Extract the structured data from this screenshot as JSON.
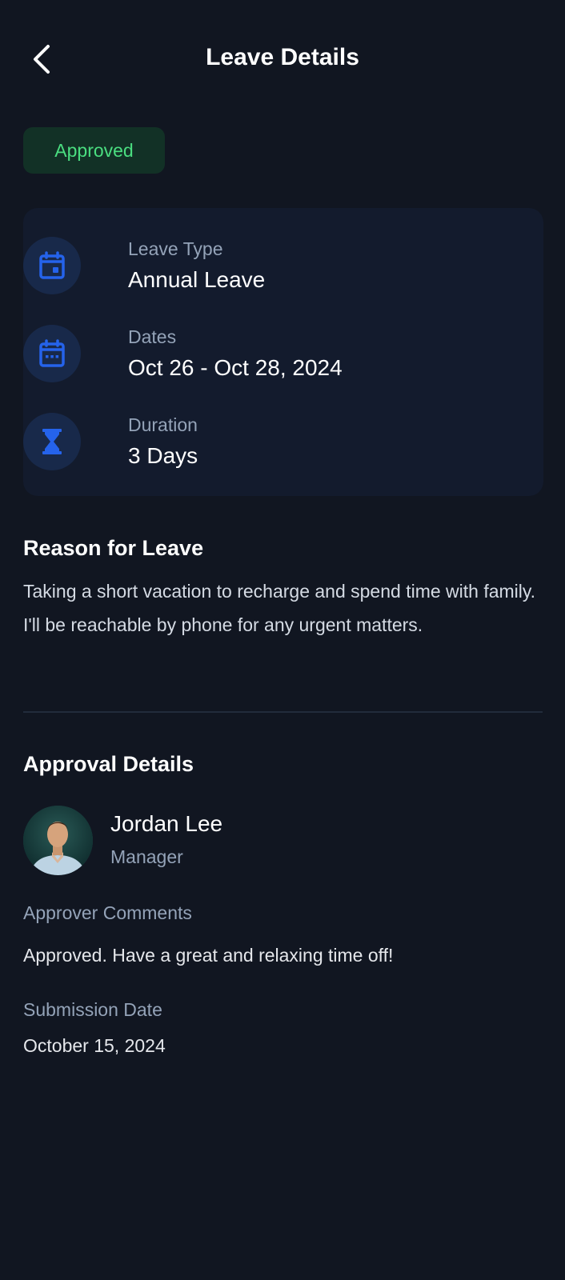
{
  "header": {
    "title": "Leave Details",
    "back_icon": "chevron-left-icon"
  },
  "status": {
    "label": "Approved",
    "color": "#4ade80",
    "background": "#123126"
  },
  "summary": {
    "items": [
      {
        "label": "Leave Type",
        "value": "Annual Leave",
        "icon": "calendar-event-icon"
      },
      {
        "label": "Dates",
        "value": "Oct 26 - Oct 28, 2024",
        "icon": "calendar-dots-icon"
      },
      {
        "label": "Duration",
        "value": "3 Days",
        "icon": "hourglass-icon"
      }
    ],
    "icon_color": "#2563eb"
  },
  "reason": {
    "title": "Reason for Leave",
    "text": "Taking a short vacation to recharge and spend time with family. I'll be reachable by phone for any urgent matters."
  },
  "approval": {
    "title": "Approval Details",
    "approver": {
      "name": "Jordan Lee",
      "role": "Manager",
      "avatar": "avatar-photo"
    },
    "comments_label": "Approver Comments",
    "comments": "Approved. Have a great and relaxing time off!",
    "submission_label": "Submission Date",
    "submission_date": "October 15, 2024"
  },
  "colors": {
    "background": "#111621",
    "card": "#131b2d",
    "accent": "#2563eb",
    "muted_text": "#94a3b8"
  }
}
